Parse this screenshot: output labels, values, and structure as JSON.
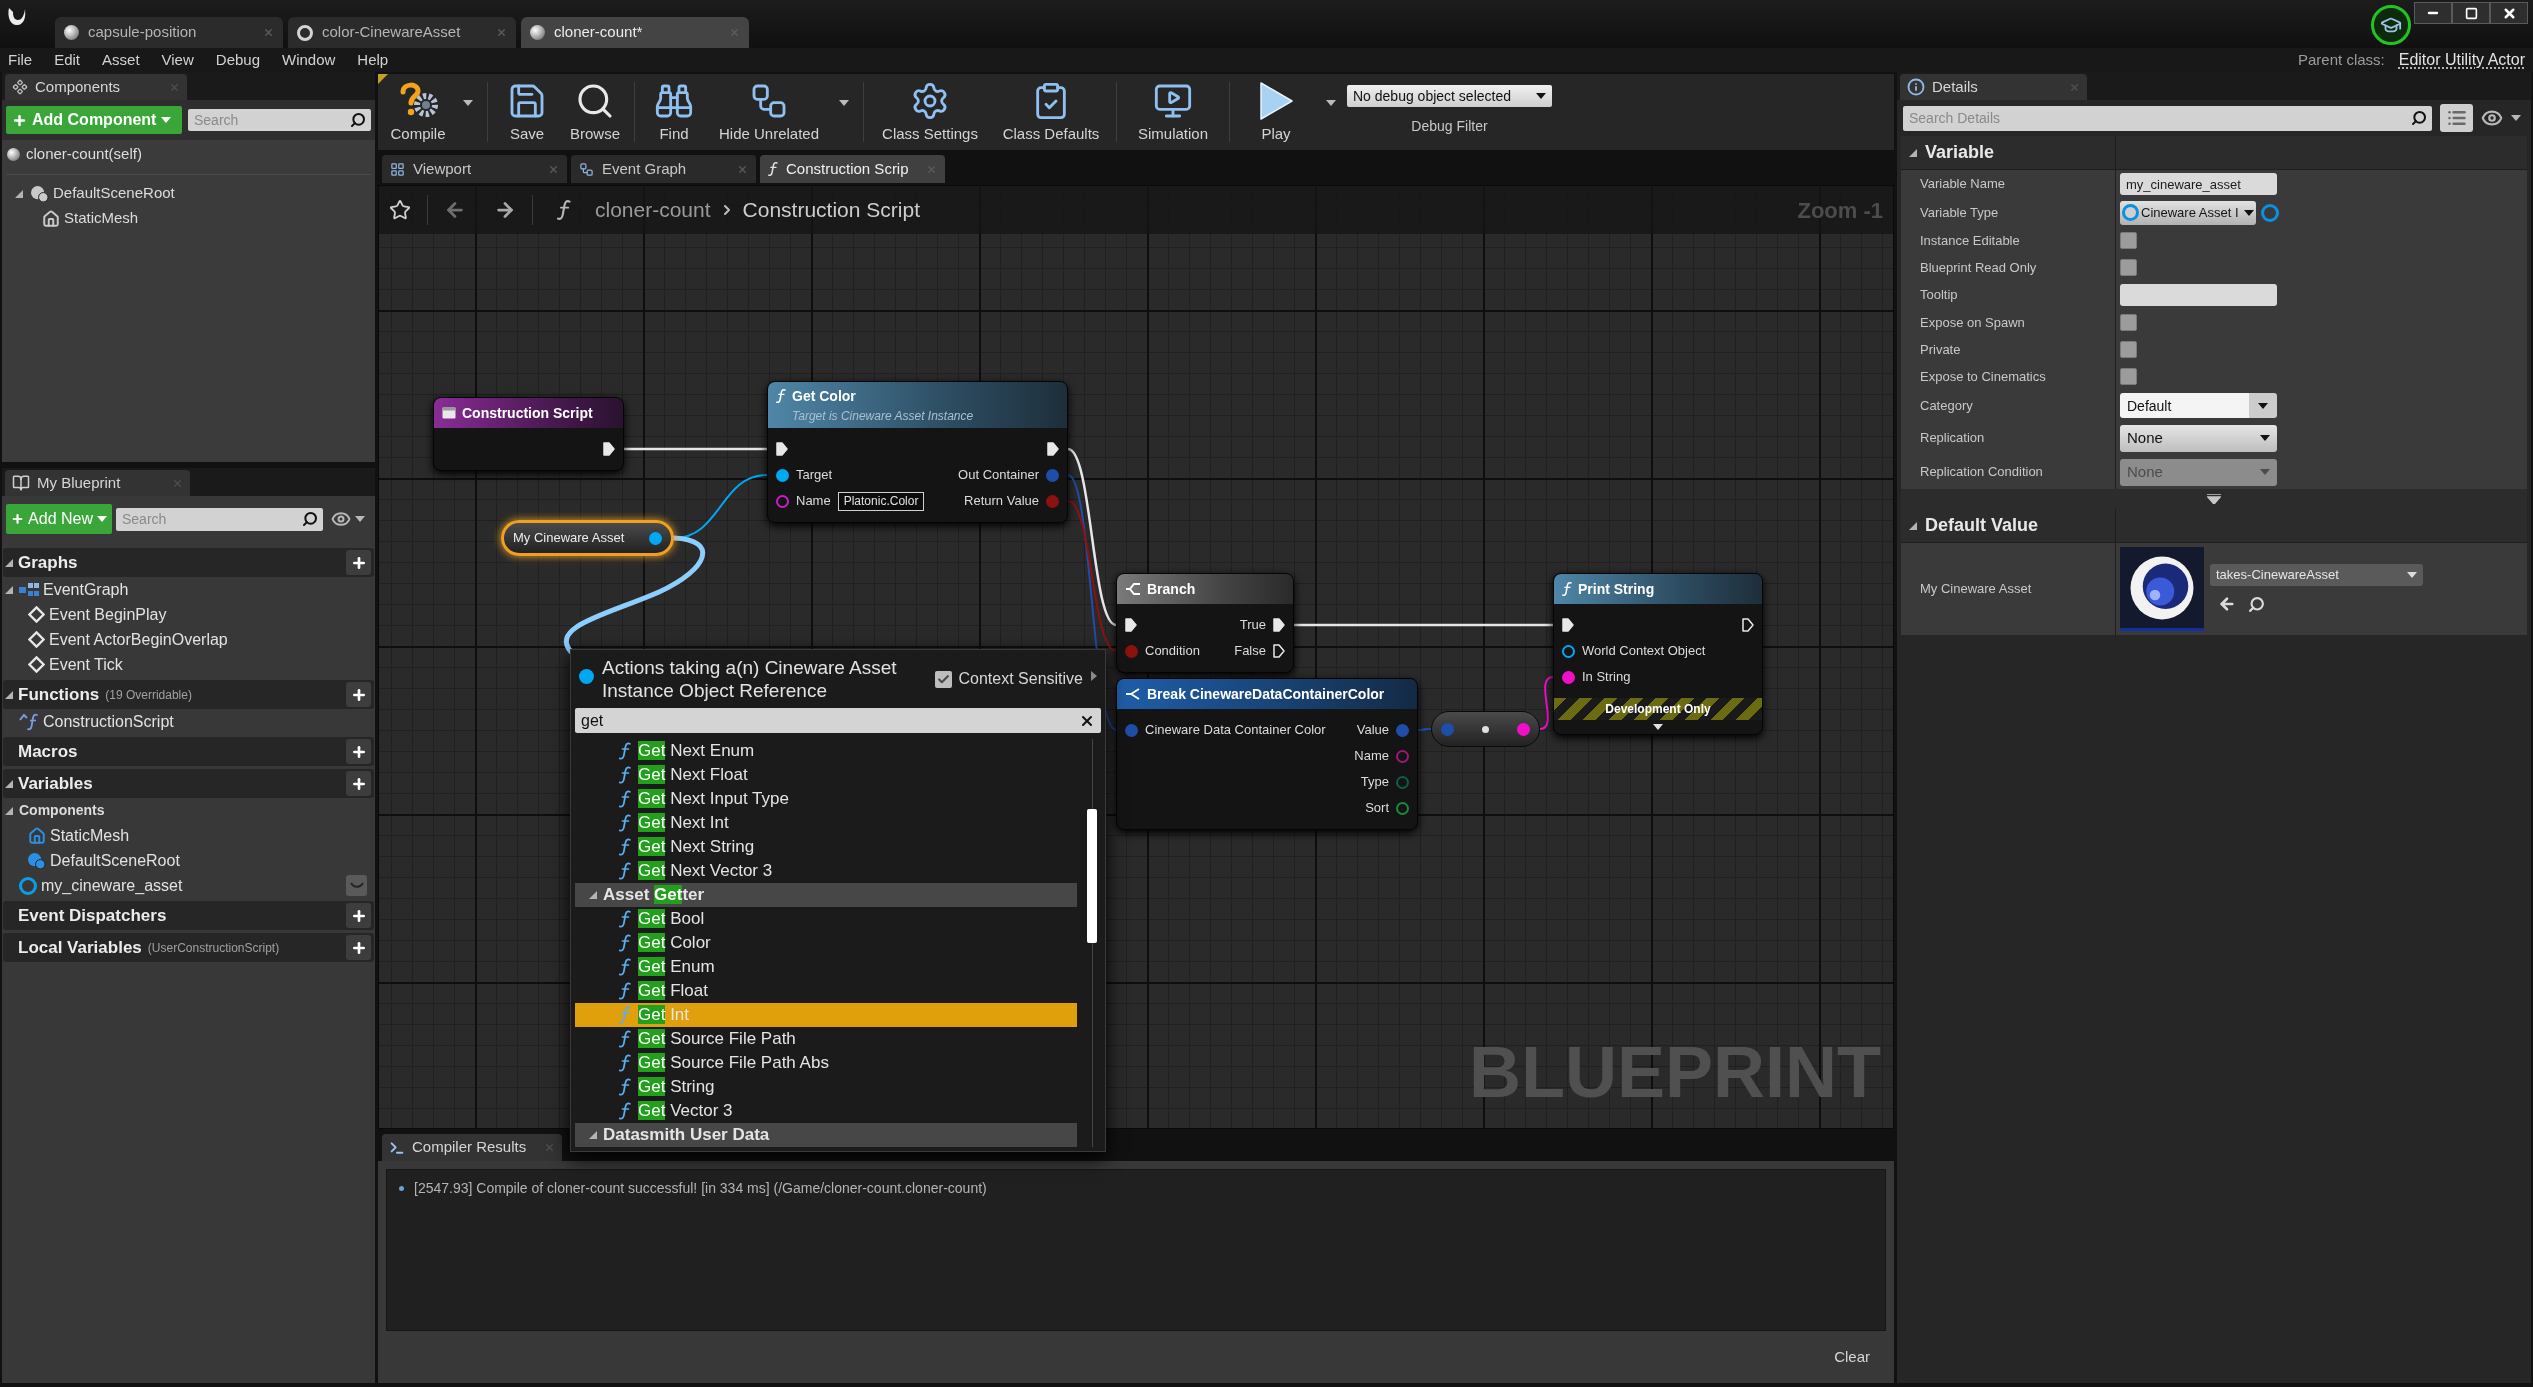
{
  "window": {
    "tabs": [
      {
        "label": "capsule-position",
        "kind": "blueprint",
        "selected": false
      },
      {
        "label": "color-CinewareAsset",
        "kind": "asset",
        "selected": false
      },
      {
        "label": "cloner-count*",
        "kind": "blueprint",
        "selected": true
      }
    ]
  },
  "menu": [
    "File",
    "Edit",
    "Asset",
    "View",
    "Debug",
    "Window",
    "Help"
  ],
  "parent_class": {
    "label": "Parent class:",
    "value": "Editor Utility Actor"
  },
  "components": {
    "title": "Components",
    "add_button": "Add Component",
    "search": {
      "placeholder": "Search"
    },
    "self_item": "cloner-count(self)",
    "tree": [
      {
        "label": "DefaultSceneRoot",
        "kind": "scene",
        "expanded": true,
        "children": [
          {
            "label": "StaticMesh",
            "kind": "mesh"
          }
        ]
      }
    ]
  },
  "my_blueprint": {
    "title": "My Blueprint",
    "add_button": "Add New",
    "search": {
      "placeholder": "Search"
    },
    "sections": [
      {
        "title": "Graphs",
        "expanded": true,
        "items": [
          {
            "label": "EventGraph",
            "kind": "graph",
            "expanded": true,
            "children": [
              {
                "label": "Event BeginPlay",
                "kind": "event"
              },
              {
                "label": "Event ActorBeginOverlap",
                "kind": "event"
              },
              {
                "label": "Event Tick",
                "kind": "event"
              }
            ]
          }
        ]
      },
      {
        "title": "Functions",
        "note": "(19 Overridable)",
        "expanded": true,
        "items": [
          {
            "label": "ConstructionScript",
            "kind": "function"
          }
        ]
      },
      {
        "title": "Macros"
      },
      {
        "title": "Variables",
        "expanded": true,
        "items": [
          {
            "label": "Components",
            "kind": "category",
            "expanded": true,
            "children": [
              {
                "label": "StaticMesh",
                "kind": "mesh"
              },
              {
                "label": "DefaultSceneRoot",
                "kind": "scene"
              }
            ]
          },
          {
            "label": "my_cineware_asset",
            "kind": "variable",
            "exposed": false
          }
        ]
      },
      {
        "title": "Event Dispatchers"
      },
      {
        "title": "Local Variables",
        "note": "(UserConstructionScript)"
      }
    ]
  },
  "toolbar": {
    "groups": [
      [
        {
          "label": "Compile",
          "kind": "compile",
          "has_menu": true
        }
      ],
      [
        {
          "label": "Save",
          "kind": "save"
        },
        {
          "label": "Browse",
          "kind": "browse"
        }
      ],
      [
        {
          "label": "Find",
          "kind": "find"
        },
        {
          "label": "Hide Unrelated",
          "kind": "hide_unrelated",
          "has_menu": true
        }
      ],
      [
        {
          "label": "Class Settings",
          "kind": "class_settings"
        },
        {
          "label": "Class Defaults",
          "kind": "class_defaults"
        }
      ],
      [
        {
          "label": "Simulation",
          "kind": "simulation"
        }
      ],
      [
        {
          "label": "Play",
          "kind": "play",
          "has_menu": true
        }
      ]
    ],
    "debug_filter": {
      "value": "No debug object selected",
      "caption": "Debug Filter"
    }
  },
  "graph_tabs": [
    {
      "label": "Viewport",
      "kind": "viewport",
      "selected": false
    },
    {
      "label": "Event Graph",
      "kind": "graph",
      "selected": false
    },
    {
      "label": "Construction Scrip",
      "kind": "function",
      "selected": true
    }
  ],
  "breadcrumb": [
    "cloner-count",
    "Construction Script"
  ],
  "graph": {
    "zoom_label": "Zoom -1",
    "watermark": "BLUEPRINT",
    "nodes": [
      {
        "kind": "event",
        "title": "Construction Script",
        "selected": false,
        "outputs": [
          {
            "kind": "exec",
            "connected": true
          }
        ]
      },
      {
        "kind": "function",
        "title": "Get Color",
        "subtitle": "Target is Cineware Asset Instance",
        "selected": false,
        "inputs": [
          {
            "kind": "exec",
            "connected": true
          },
          {
            "kind": "data",
            "label": "Target",
            "color": "#00a8f4",
            "connected": true
          },
          {
            "kind": "data",
            "label": "Name",
            "color": "#c81ec8",
            "connected": false,
            "default": "Platonic.Color"
          }
        ],
        "outputs": [
          {
            "kind": "exec",
            "connected": true
          },
          {
            "kind": "data",
            "label": "Out Container",
            "color": "#1f4ea8",
            "connected": true
          },
          {
            "kind": "data",
            "label": "Return Value",
            "color": "#8c1212",
            "connected": true
          }
        ]
      },
      {
        "kind": "variable",
        "title": "My Cineware Asset",
        "selected": true,
        "outputs": [
          {
            "kind": "data",
            "color": "#00a8f4",
            "connected": true
          }
        ]
      },
      {
        "kind": "flow",
        "title": "Branch",
        "selected": false,
        "inputs": [
          {
            "kind": "exec",
            "connected": true
          },
          {
            "kind": "data",
            "label": "Condition",
            "color": "#8c1212",
            "connected": true
          }
        ],
        "outputs": [
          {
            "kind": "exec",
            "label": "True",
            "connected": true
          },
          {
            "kind": "exec",
            "label": "False",
            "connected": false
          }
        ]
      },
      {
        "kind": "function",
        "title": "Print String",
        "selected": false,
        "footer": "Development Only",
        "inputs": [
          {
            "kind": "exec",
            "connected": true
          },
          {
            "kind": "data",
            "label": "World Context Object",
            "color": "#00a8f4",
            "connected": false
          },
          {
            "kind": "data",
            "label": "In String",
            "color": "#f010c8",
            "connected": true
          }
        ],
        "outputs": [
          {
            "kind": "exec",
            "connected": false
          }
        ]
      },
      {
        "kind": "struct",
        "title": "Break CinewareDataContainerColor",
        "selected": false,
        "inputs": [
          {
            "kind": "data",
            "label": "Cineware Data Container Color",
            "color": "#1f4ea8",
            "connected": true
          }
        ],
        "outputs": [
          {
            "kind": "data",
            "label": "Value",
            "color": "#1f4ea8",
            "connected": true
          },
          {
            "kind": "data",
            "label": "Name",
            "color": "#a0167a",
            "connected": false
          },
          {
            "kind": "data",
            "label": "Type",
            "color": "#0e5c4a",
            "connected": false
          },
          {
            "kind": "data",
            "label": "Sort",
            "color": "#1d8a3c",
            "connected": false
          }
        ]
      },
      {
        "kind": "conversion",
        "selected": false,
        "inputs": [
          {
            "kind": "data",
            "color": "#1f4ea8",
            "connected": true
          }
        ],
        "outputs": [
          {
            "kind": "data",
            "color": "#f010c8",
            "connected": true
          }
        ]
      }
    ],
    "action_menu": {
      "title": "Actions taking a(n) Cineware Asset Instance Object Reference",
      "context_sensitive": {
        "label": "Context Sensitive",
        "checked": true
      },
      "search": {
        "value": "get"
      },
      "items": [
        {
          "kind": "action",
          "selected": false,
          "parts": [
            {
              "text": "Get",
              "match": true
            },
            {
              "text": " Next Enum",
              "match": false
            }
          ]
        },
        {
          "kind": "action",
          "selected": false,
          "parts": [
            {
              "text": "Get",
              "match": true
            },
            {
              "text": " Next Float",
              "match": false
            }
          ]
        },
        {
          "kind": "action",
          "selected": false,
          "parts": [
            {
              "text": "Get",
              "match": true
            },
            {
              "text": " Next Input Type",
              "match": false
            }
          ]
        },
        {
          "kind": "action",
          "selected": false,
          "parts": [
            {
              "text": "Get",
              "match": true
            },
            {
              "text": " Next Int",
              "match": false
            }
          ]
        },
        {
          "kind": "action",
          "selected": false,
          "parts": [
            {
              "text": "Get",
              "match": true
            },
            {
              "text": " Next String",
              "match": false
            }
          ]
        },
        {
          "kind": "action",
          "selected": false,
          "parts": [
            {
              "text": "Get",
              "match": true
            },
            {
              "text": " Next Vector 3",
              "match": false
            }
          ]
        },
        {
          "kind": "category",
          "selected": false,
          "expanded": true,
          "parts": [
            {
              "text": "Asset ",
              "match": false
            },
            {
              "text": "Get",
              "match": true
            },
            {
              "text": "ter",
              "match": false
            }
          ],
          "children": [
            {
              "kind": "action",
              "selected": false,
              "parts": [
                {
                  "text": "Get",
                  "match": true
                },
                {
                  "text": " Bool",
                  "match": false
                }
              ]
            },
            {
              "kind": "action",
              "selected": false,
              "parts": [
                {
                  "text": "Get",
                  "match": true
                },
                {
                  "text": " Color",
                  "match": false
                }
              ]
            },
            {
              "kind": "action",
              "selected": false,
              "parts": [
                {
                  "text": "Get",
                  "match": true
                },
                {
                  "text": " Enum",
                  "match": false
                }
              ]
            },
            {
              "kind": "action",
              "selected": false,
              "parts": [
                {
                  "text": "Get",
                  "match": true
                },
                {
                  "text": " Float",
                  "match": false
                }
              ]
            },
            {
              "kind": "action",
              "selected": true,
              "parts": [
                {
                  "text": "Get",
                  "match": true
                },
                {
                  "text": " Int",
                  "match": false
                }
              ]
            },
            {
              "kind": "action",
              "selected": false,
              "parts": [
                {
                  "text": "Get",
                  "match": true
                },
                {
                  "text": " Source File Path",
                  "match": false
                }
              ]
            },
            {
              "kind": "action",
              "selected": false,
              "parts": [
                {
                  "text": "Get",
                  "match": true
                },
                {
                  "text": " Source File Path Abs",
                  "match": false
                }
              ]
            },
            {
              "kind": "action",
              "selected": false,
              "parts": [
                {
                  "text": "Get",
                  "match": true
                },
                {
                  "text": " String",
                  "match": false
                }
              ]
            },
            {
              "kind": "action",
              "selected": false,
              "parts": [
                {
                  "text": "Get",
                  "match": true
                },
                {
                  "text": " Vector 3",
                  "match": false
                }
              ]
            }
          ]
        },
        {
          "kind": "category",
          "selected": false,
          "expanded": true,
          "parts": [
            {
              "text": "Datasmith User Data",
              "match": false
            }
          ]
        }
      ]
    }
  },
  "compiler_results": {
    "title": "Compiler Results",
    "messages": [
      "[2547.93] Compile of cloner-count successful! [in 334 ms] (/Game/cloner-count.cloner-count)"
    ],
    "clear_button": "Clear"
  },
  "details": {
    "title": "Details",
    "search": {
      "placeholder": "Search Details"
    },
    "sections": [
      {
        "title": "Variable",
        "expanded": true,
        "more_toggle": true,
        "rows": [
          {
            "label": "Variable Name",
            "kind": "text",
            "value": "my_cineware_asset",
            "disabled": false
          },
          {
            "label": "Variable Type",
            "kind": "type",
            "value": "Cineware Asset I",
            "disabled": false
          },
          {
            "label": "Instance Editable",
            "kind": "checkbox",
            "checked": false,
            "disabled": false
          },
          {
            "label": "Blueprint Read Only",
            "kind": "checkbox",
            "checked": false,
            "disabled": false
          },
          {
            "label": "Tooltip",
            "kind": "text",
            "disabled": false
          },
          {
            "label": "Expose on Spawn",
            "kind": "checkbox",
            "checked": false,
            "disabled": false
          },
          {
            "label": "Private",
            "kind": "checkbox",
            "checked": false,
            "disabled": false
          },
          {
            "label": "Expose to Cinematics",
            "kind": "checkbox",
            "checked": false,
            "disabled": false
          },
          {
            "label": "Category",
            "kind": "combo",
            "value": "Default",
            "disabled": false
          },
          {
            "label": "Replication",
            "kind": "dropdown",
            "value": "None",
            "disabled": false
          },
          {
            "label": "Replication Condition",
            "kind": "dropdown",
            "value": "None",
            "disabled": true
          }
        ]
      },
      {
        "title": "Default Value",
        "expanded": true,
        "rows": [
          {
            "label": "My Cineware Asset",
            "kind": "asset",
            "value": "takes-CinewareAsset",
            "disabled": false
          }
        ]
      }
    ]
  }
}
